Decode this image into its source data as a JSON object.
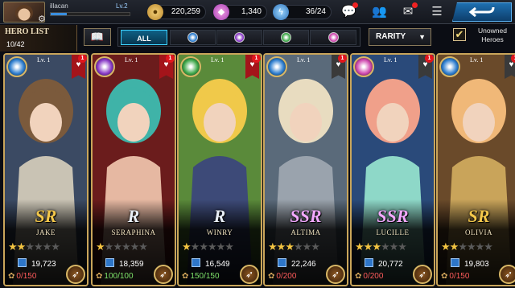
{
  "player": {
    "name": "illacan",
    "level": "Lv.2",
    "xp_fraction": 0.2
  },
  "resources": {
    "gold": "220,259",
    "gems": "1,340",
    "energy": "36/24"
  },
  "icons": {
    "gold": "gold-coin-icon",
    "gems": "gem-icon",
    "energy": "energy-icon",
    "chat": "chat-icon",
    "friends": "friends-icon",
    "mail": "mail-icon",
    "menu": "menu-icon",
    "back": "back-arrow-icon"
  },
  "hero_list": {
    "title": "HERO LIST",
    "count": "10/42"
  },
  "filters": {
    "all_label": "ALL",
    "elements": [
      "water",
      "dark",
      "wind",
      "light"
    ],
    "element_colors": [
      "#2f7fd0",
      "#8a3bc7",
      "#3fa84a",
      "#d04ab0"
    ]
  },
  "sort": {
    "label": "RARITY"
  },
  "unowned": {
    "checked": true,
    "label": "Unowned Heroes"
  },
  "heroes": [
    {
      "name": "JAKE",
      "rank": "SR",
      "level": "Lv. 1",
      "stars": 2,
      "power": "19,723",
      "souls": "0/150",
      "souls_color": "#ff5b5b",
      "favorite": true,
      "notif": "1",
      "element_color": "#2f7fd0",
      "rank_color": "#f3c74a",
      "art": [
        "#7b5a3c",
        "#c9c3b4",
        "#3b4a63"
      ]
    },
    {
      "name": "SERAPHINA",
      "rank": "R",
      "level": "Lv. 1",
      "stars": 1,
      "power": "18,359",
      "souls": "100/100",
      "souls_color": "#7ee36a",
      "favorite": true,
      "notif": "1",
      "element_color": "#8a3bc7",
      "rank_color": "#e8eef6",
      "art": [
        "#3fb3a8",
        "#e6b8a2",
        "#6b1c1c"
      ]
    },
    {
      "name": "WINRY",
      "rank": "R",
      "level": "Lv. 1",
      "stars": 1,
      "power": "16,549",
      "souls": "150/150",
      "souls_color": "#7ee36a",
      "favorite": true,
      "notif": "1",
      "element_color": "#3fa84a",
      "rank_color": "#e8eef6",
      "art": [
        "#f0c94a",
        "#3d4a78",
        "#5a8a3a"
      ]
    },
    {
      "name": "ALTIMA",
      "rank": "SSR",
      "level": "Lv. 1",
      "stars": 3,
      "power": "22,246",
      "souls": "0/200",
      "souls_color": "#ff5b5b",
      "favorite": false,
      "notif": "1",
      "element_color": "#2f7fd0",
      "rank_color": "#f2a8ff",
      "art": [
        "#e8dcc0",
        "#9aa3ad",
        "#5a6a7a"
      ]
    },
    {
      "name": "LUCILLE",
      "rank": "SSR",
      "level": "Lv. 1",
      "stars": 3,
      "power": "20,772",
      "souls": "0/200",
      "souls_color": "#ff5b5b",
      "favorite": false,
      "notif": "1",
      "element_color": "#d04ab0",
      "rank_color": "#f2a8ff",
      "art": [
        "#f0a08a",
        "#8ed8c8",
        "#2a4a7a"
      ]
    },
    {
      "name": "OLIVIA",
      "rank": "SR",
      "level": "Lv. 1",
      "stars": 2,
      "power": "19,803",
      "souls": "0/150",
      "souls_color": "#ff5b5b",
      "favorite": false,
      "notif": "1",
      "element_color": "#2f7fd0",
      "rank_color": "#f3c74a",
      "art": [
        "#f0b878",
        "#c9a45a",
        "#6a4a2a"
      ]
    }
  ]
}
